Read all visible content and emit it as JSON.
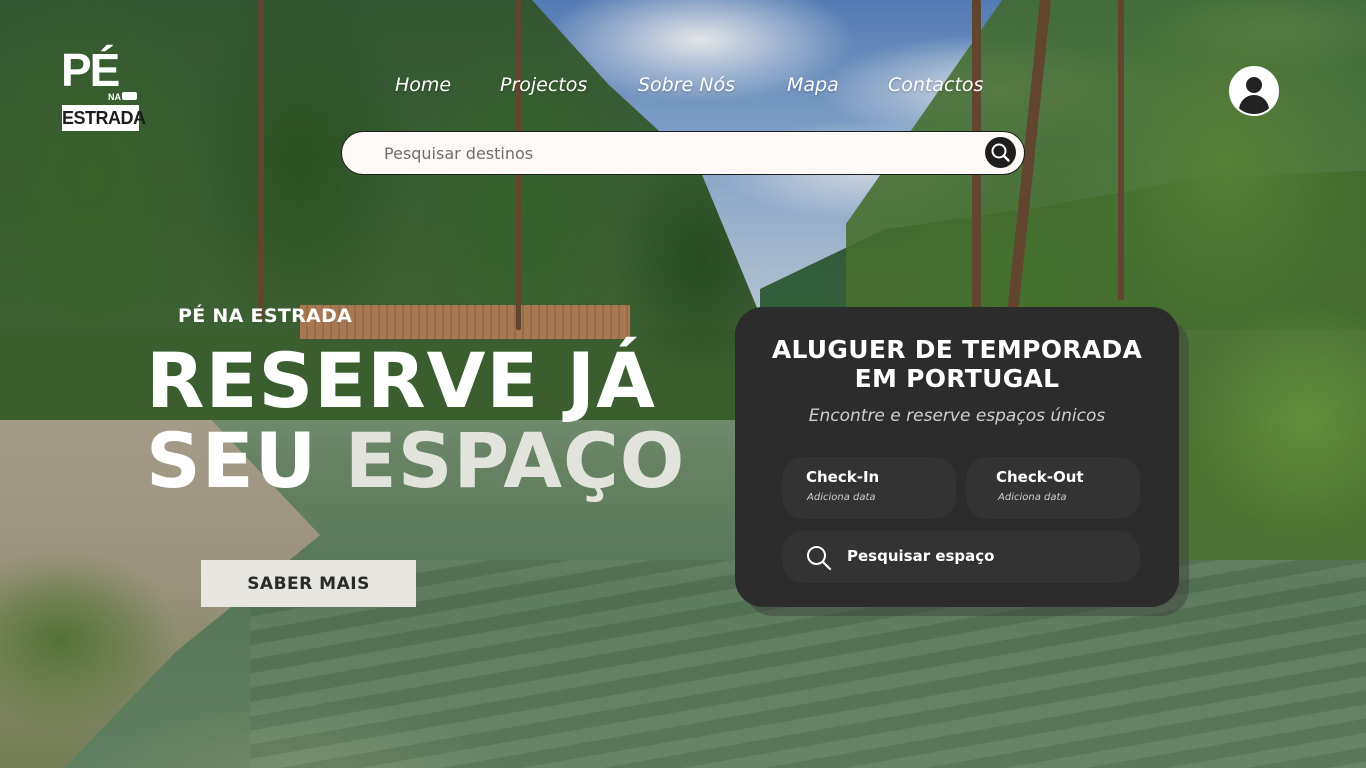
{
  "brand": {
    "logo_top": "PÉ",
    "logo_na": "NA",
    "logo_bottom": "ESTRADA"
  },
  "nav": {
    "items": [
      {
        "label": "Home"
      },
      {
        "label": "Projectos"
      },
      {
        "label": "Sobre Nós"
      },
      {
        "label": "Mapa"
      },
      {
        "label": "Contactos"
      }
    ]
  },
  "search": {
    "placeholder": "Pesquisar destinos",
    "value": "",
    "icon": "search-icon"
  },
  "user": {
    "icon": "user-avatar-icon"
  },
  "hero": {
    "kicker": "PÉ NA ESTRADA",
    "line1": "RESERVE JÁ",
    "line2_plain": "SEU ",
    "line2_accent": "ESPAÇO",
    "cta_label": "SABER MAIS"
  },
  "booking": {
    "title_line1": "ALUGUER DE TEMPORADA",
    "title_line2": "EM PORTUGAL",
    "subtitle": "Encontre e reserve espaços únicos",
    "checkin_label": "Check-In",
    "checkin_hint": "Adiciona data",
    "checkout_label": "Check-Out",
    "checkout_hint": "Adiciona data",
    "search_label": "Pesquisar espaço",
    "search_icon": "search-icon"
  },
  "colors": {
    "card_bg": "#2c2c2c",
    "field_bg": "#333333",
    "cta_bg": "#e6e5e0",
    "text_light": "#ffffff",
    "accent_text": "#e3e3dd"
  }
}
